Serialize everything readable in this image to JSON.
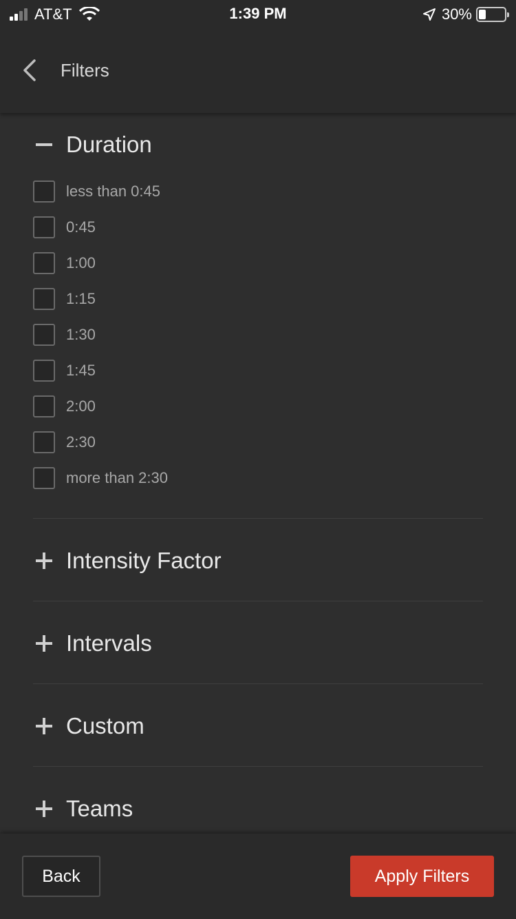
{
  "status_bar": {
    "carrier": "AT&T",
    "time": "1:39 PM",
    "battery_percent": "30%"
  },
  "nav": {
    "title": "Filters"
  },
  "duration": {
    "title": "Duration",
    "options": [
      "less than 0:45",
      "0:45",
      "1:00",
      "1:15",
      "1:30",
      "1:45",
      "2:00",
      "2:30",
      "more than 2:30"
    ]
  },
  "sections": [
    {
      "title": "Intensity Factor"
    },
    {
      "title": "Intervals"
    },
    {
      "title": "Custom"
    },
    {
      "title": "Teams"
    }
  ],
  "footer": {
    "back_label": "Back",
    "apply_label": "Apply Filters"
  },
  "colors": {
    "accent": "#c93a2a",
    "background": "#2e2e2e"
  }
}
